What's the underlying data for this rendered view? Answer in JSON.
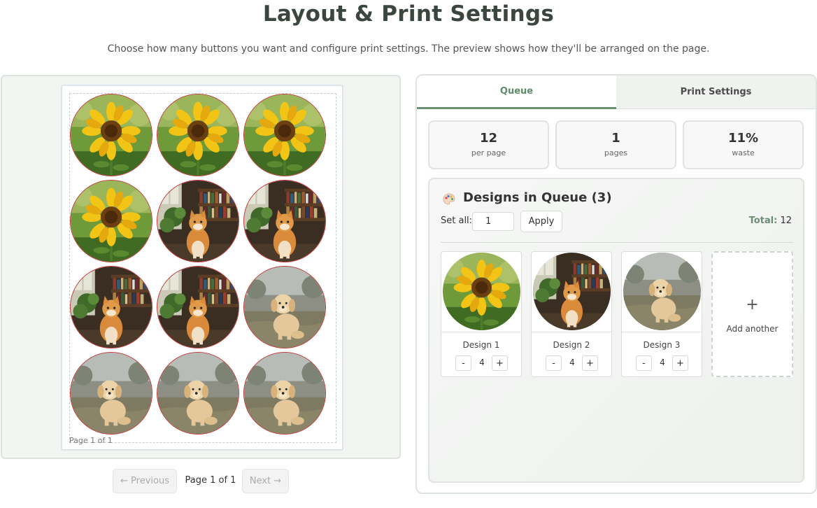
{
  "header": {
    "title": "Layout & Print Settings",
    "subtitle": "Choose how many buttons you want and configure print settings. The preview shows how they'll be arranged on the page."
  },
  "preview": {
    "sheet_label": "Page 1 of 1",
    "grid": [
      "sunflower",
      "sunflower",
      "sunflower",
      "sunflower",
      "cat",
      "cat",
      "cat",
      "cat",
      "puppy",
      "puppy",
      "puppy",
      "puppy"
    ]
  },
  "pagination": {
    "prev_label": "← Previous",
    "page_text": "Page 1 of 1",
    "next_label": "Next →"
  },
  "tabs": [
    {
      "label": "Queue",
      "active": true
    },
    {
      "label": "Print Settings",
      "active": false
    }
  ],
  "stats": [
    {
      "value": "12",
      "label": "per page"
    },
    {
      "value": "1",
      "label": "pages"
    },
    {
      "value": "11%",
      "label": "waste"
    }
  ],
  "queue": {
    "title": "Designs in Queue (3)",
    "icon": "palette-icon",
    "set_all_label": "Set all:",
    "set_all_value": "1",
    "apply_label": "Apply",
    "total_label": "Total:",
    "total_value": "12",
    "designs": [
      {
        "name": "Design 1",
        "qty": "4",
        "image": "sunflower"
      },
      {
        "name": "Design 2",
        "qty": "4",
        "image": "cat"
      },
      {
        "name": "Design 3",
        "qty": "4",
        "image": "puppy"
      }
    ],
    "minus_label": "-",
    "plus_label": "+",
    "add_symbol": "+",
    "add_label": "Add another"
  },
  "colors": {
    "accent": "#6a8f73",
    "cut_line": "#c23a3a"
  }
}
